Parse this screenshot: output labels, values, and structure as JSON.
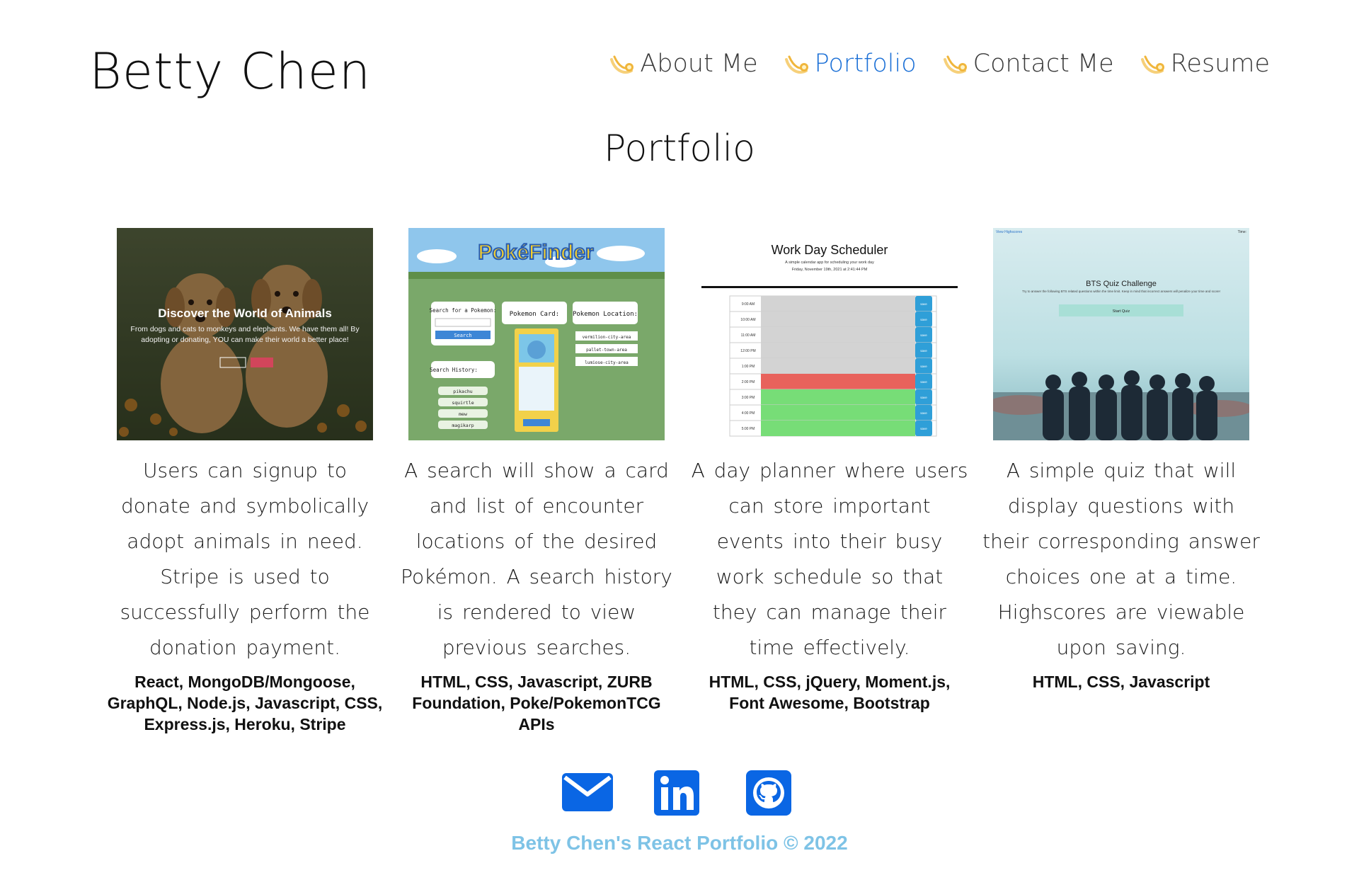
{
  "header": {
    "brand": "Betty Chen",
    "nav": [
      {
        "label": "About Me",
        "icon": "sparkle-comet-icon",
        "active": false
      },
      {
        "label": "Portfolio",
        "icon": "sparkle-comet-icon",
        "active": true
      },
      {
        "label": "Contact Me",
        "icon": "sparkle-comet-icon",
        "active": false
      },
      {
        "label": "Resume",
        "icon": "sparkle-comet-icon",
        "active": false
      }
    ]
  },
  "page_title": "Portfolio",
  "projects": [
    {
      "thumb": {
        "heading": "Discover the World of Animals",
        "text": "From dogs and cats to monkeys and elephants. We have them all! By adopting or donating, YOU can make their world a better place!"
      },
      "description": "Users can signup to donate and symbolically adopt animals in need. Stripe is used to successfully perform the donation payment.",
      "tech": "React, MongoDB/Mongoose, GraphQL, Node.js, Javascript, CSS, Express.js, Heroku, Stripe"
    },
    {
      "thumb": {
        "logo": "PokéFinder",
        "search_label": "Search for a Pokemon:",
        "search_button": "Search",
        "history_label": "Search History:",
        "history": [
          "pikachu",
          "squirtle",
          "mew",
          "magikarp"
        ],
        "card_label": "Pokemon Card:",
        "location_label": "Pokemon Location:",
        "locations": [
          "vermilion-city-area",
          "pallet-town-area",
          "lumiose-city-area"
        ]
      },
      "description": "A search will show a card and list of encounter locations of the desired Pokémon. A search history is rendered to view previous searches.",
      "tech": "HTML, CSS, Javascript, ZURB Foundation, Poke/PokemonTCG APIs"
    },
    {
      "thumb": {
        "title": "Work Day Scheduler",
        "subtitle": "A simple calendar app for scheduling your work day",
        "date": "Friday, November 19th, 2021 at 2:41:44 PM",
        "hours": [
          "9:00 AM",
          "10:00 AM",
          "11:00 AM",
          "12:00 PM",
          "1:00 PM",
          "2:00 PM",
          "3:00 PM",
          "4:00 PM",
          "5:00 PM"
        ],
        "save_label": "save"
      },
      "description": "A day planner where users can store important events into their busy work schedule so that they can manage their time effectively.",
      "tech": "HTML, CSS, jQuery, Moment.js, Font Awesome, Bootstrap"
    },
    {
      "thumb": {
        "highscores_link": "View Highscores",
        "timer": "Time:",
        "title": "BTS Quiz Challenge",
        "text": "Try to answer the following BTS related questions within the time limit. Keep in mind that incorrect answers will penalize your time and score!",
        "button": "Start Quiz"
      },
      "description": "A simple quiz that will display questions with their corresponding answer choices one at a time. Highscores are viewable upon saving.",
      "tech": "HTML, CSS, Javascript"
    }
  ],
  "socials": [
    {
      "name": "email",
      "icon": "envelope-icon"
    },
    {
      "name": "linkedin",
      "icon": "linkedin-icon"
    },
    {
      "name": "github",
      "icon": "github-icon"
    }
  ],
  "footer": "Betty Chen's React Portfolio © 2022",
  "colors": {
    "accent": "#1a6fd6",
    "social_blue": "#0a66e4",
    "footer": "#7ec3e6",
    "icon_gold": "#f0b63c"
  }
}
